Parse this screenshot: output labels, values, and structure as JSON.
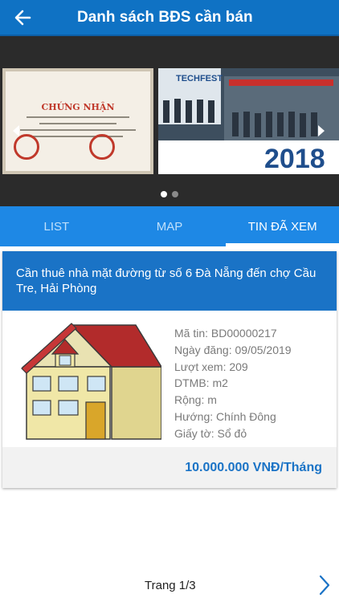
{
  "header": {
    "title": "Danh sách BĐS cần bán",
    "back_icon": "arrow-left-icon",
    "background": "#0f72c4"
  },
  "slider": {
    "slides": [
      {
        "title": "CHỨNG NHẬN"
      },
      {
        "title": "TECHFEST",
        "year": "2018"
      }
    ],
    "active_dot": 0,
    "dot_count": 2
  },
  "tabs": [
    {
      "label": "LIST",
      "active": false
    },
    {
      "label": "MAP",
      "active": false
    },
    {
      "label": "TIN ĐÃ XEM",
      "active": true
    }
  ],
  "listing": {
    "title": "Cần thuê nhà mặt đường từ số 6 Đà Nẵng đến chợ Cầu Tre, Hải Phòng",
    "image_icon": "house-icon",
    "rows": [
      "Mã tin: BD00000217",
      "Ngày đăng: 09/05/2019",
      "Lượt xem: 209",
      "DTMB:  m2",
      "Rộng:  m",
      "Hướng: Chính Đông",
      "Giấy tờ: Sổ đỏ"
    ],
    "price": "10.000.000 VNĐ/Tháng"
  },
  "pager": {
    "label": "Trang 1/3",
    "next_icon": "chevron-right-icon"
  },
  "colors": {
    "primary": "#1a73c6",
    "tab_bar": "#1e88e5"
  }
}
